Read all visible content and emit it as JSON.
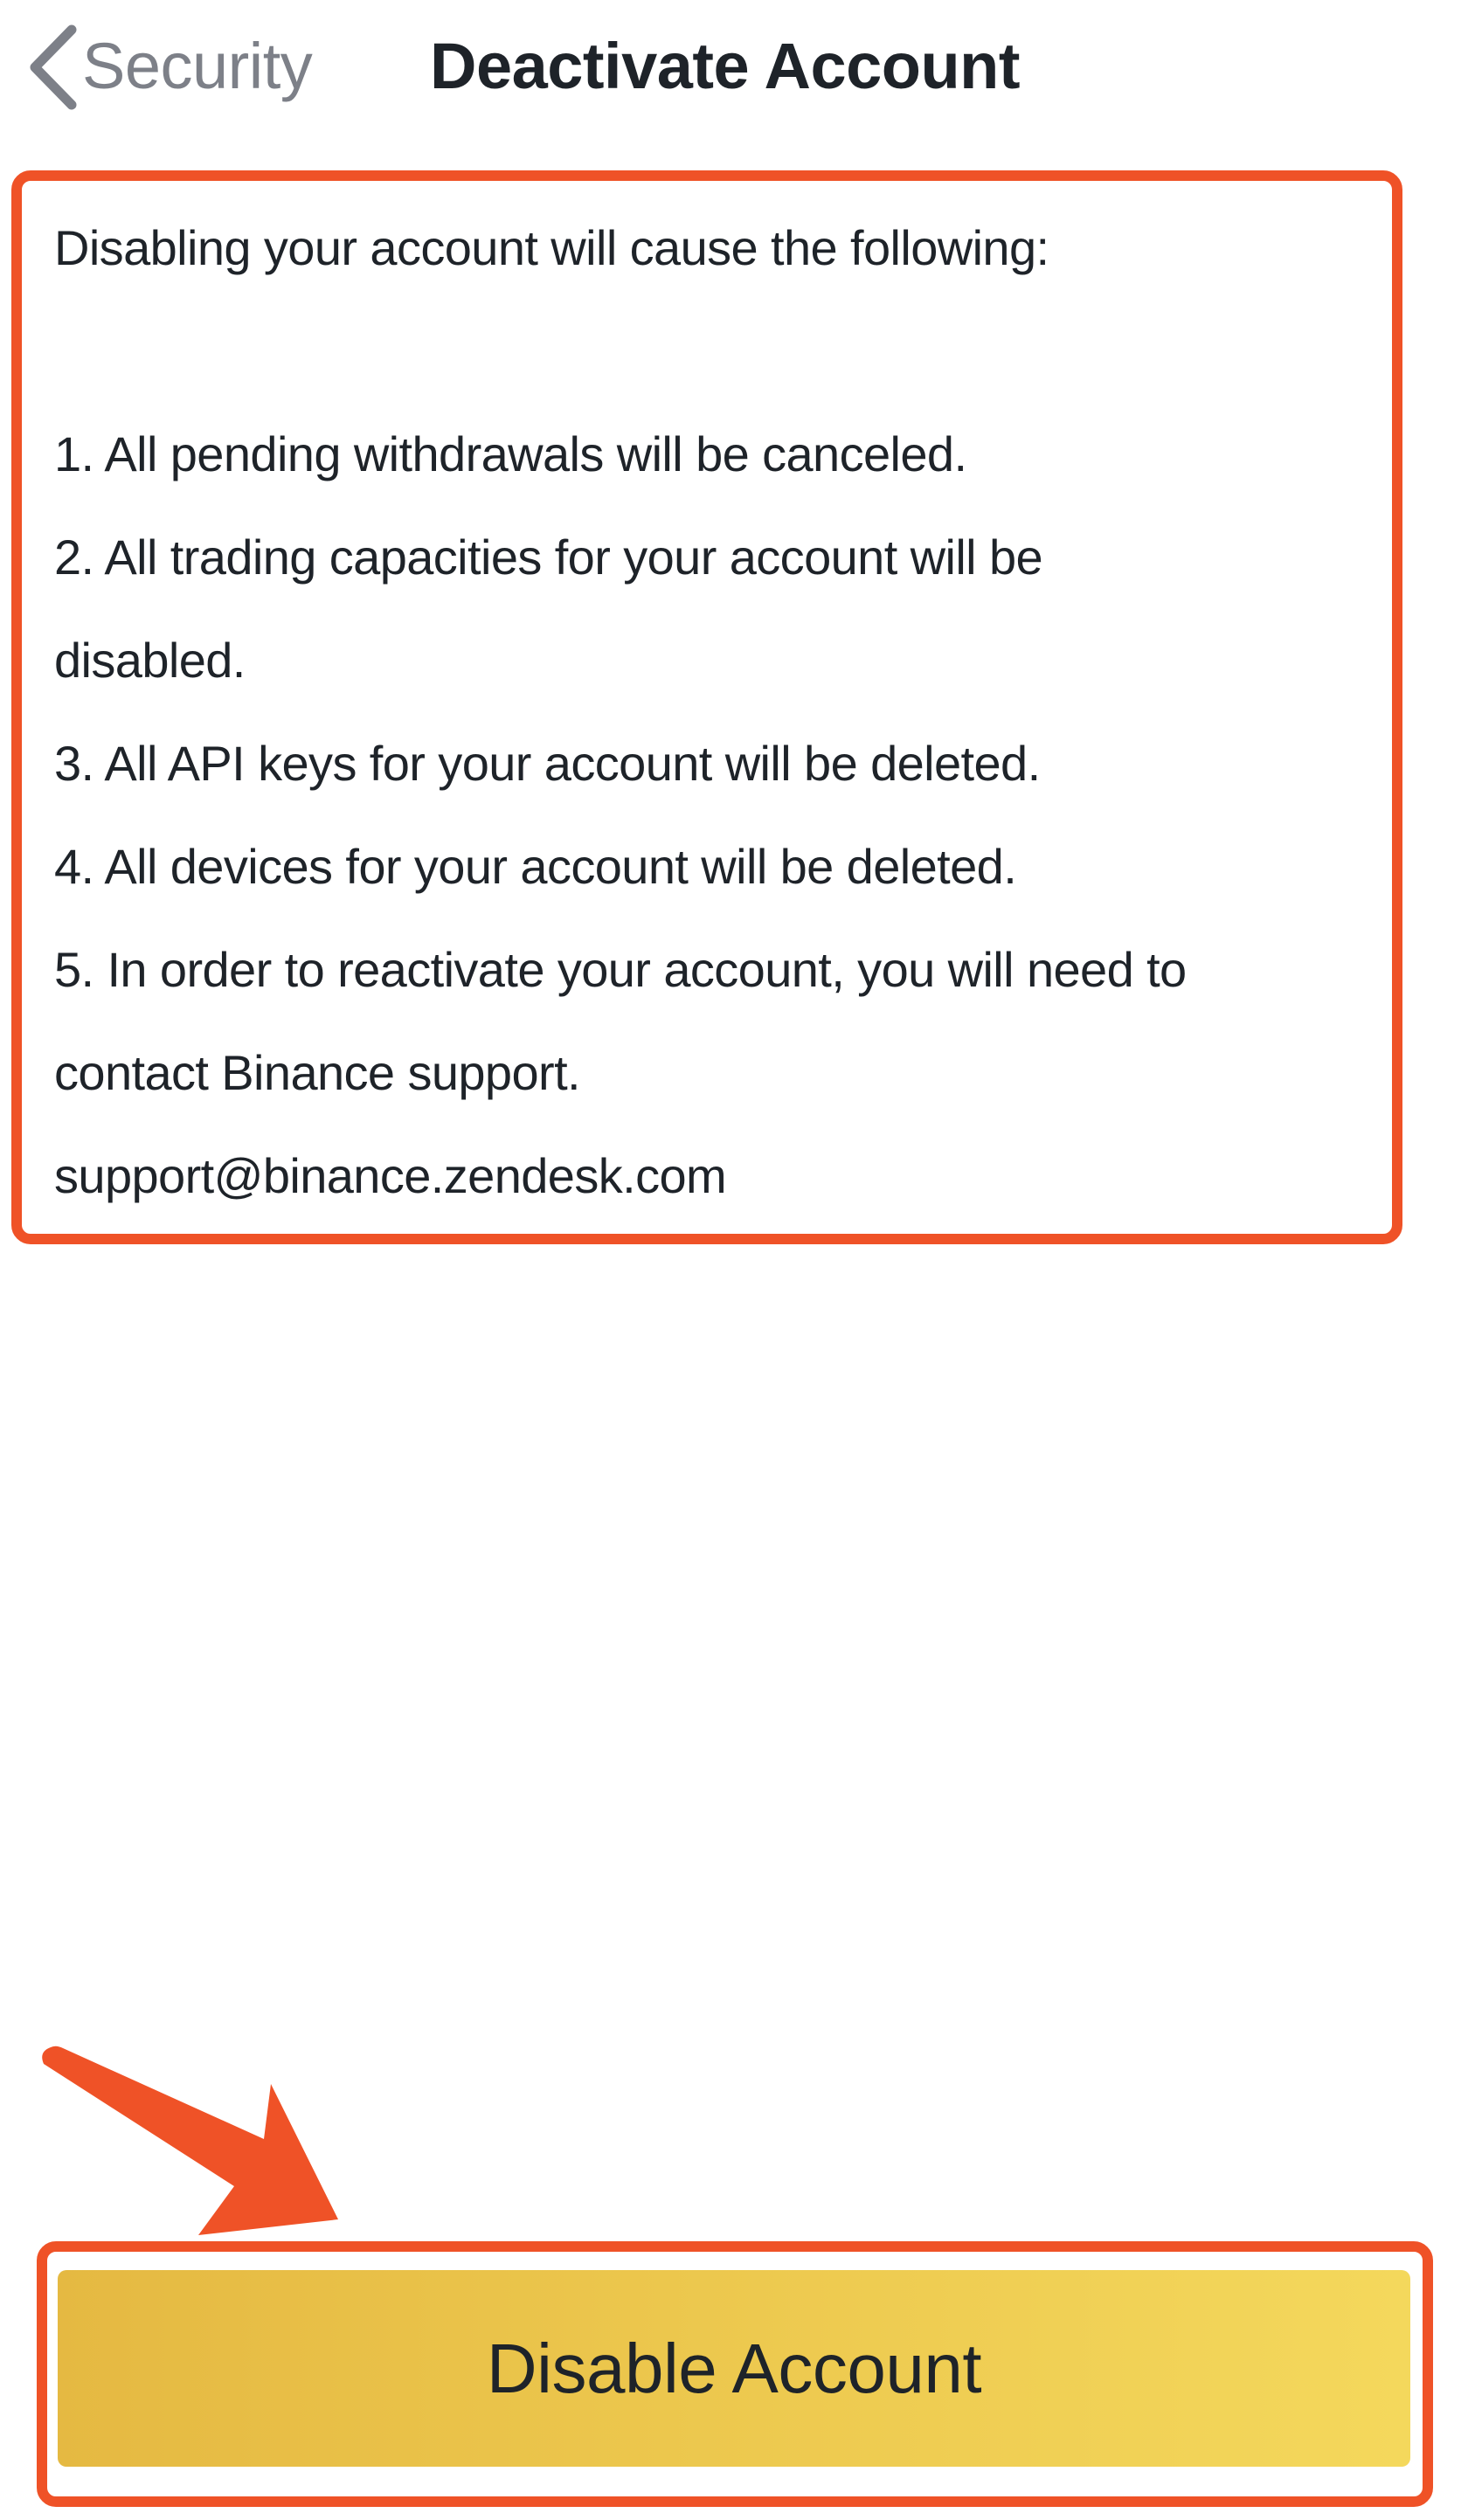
{
  "header": {
    "back_label": "Security",
    "title": "Deactivate Account",
    "back_icon": "chevron-left-icon"
  },
  "info": {
    "intro": "Disabling your account will cause the following:",
    "lines": [
      "1. All pending withdrawals will be canceled.",
      "2. All trading capacities for your account will be",
      "disabled.",
      "3. All API keys for your account will be deleted.",
      "4. All devices for your account will be deleted.",
      "5. In order to reactivate your account, you will need to",
      "contact Binance support.",
      "support@binance.zendesk.com"
    ]
  },
  "action": {
    "disable_label": "Disable Account"
  },
  "colors": {
    "highlight": "#ef5227",
    "button_start": "#e5b942",
    "button_end": "#f4d85c",
    "text": "#1e2329",
    "muted": "#7d8088"
  }
}
